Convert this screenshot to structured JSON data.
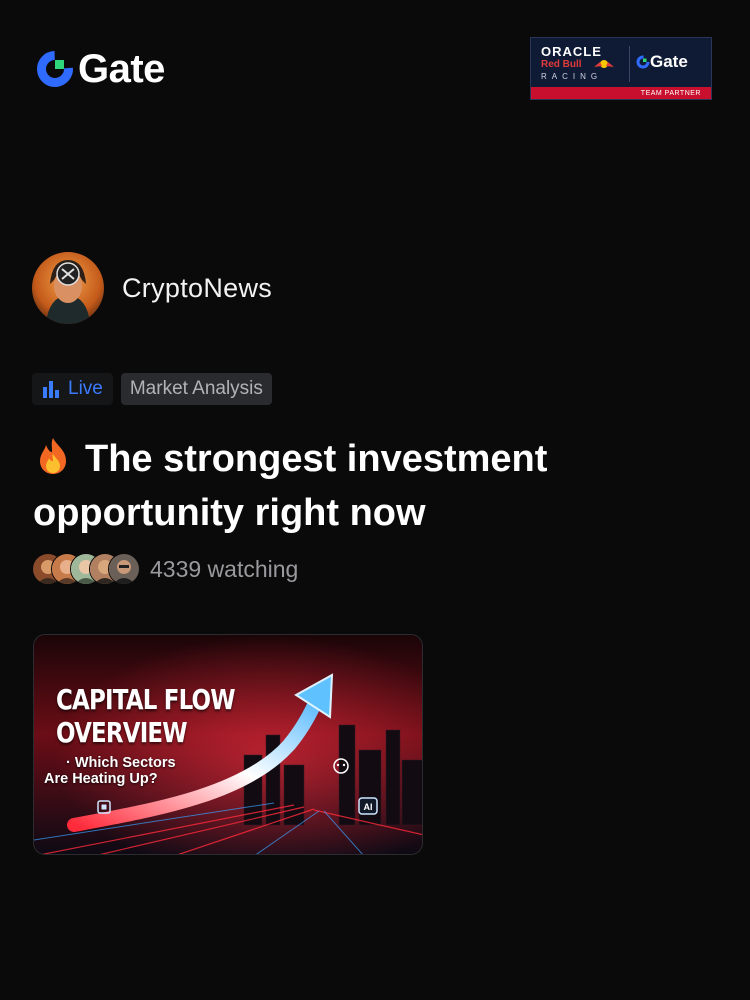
{
  "header": {
    "logo_text": "Gate",
    "partner": {
      "oracle": "ORACLE",
      "redbull": "Red Bull",
      "racing": "RACING",
      "gate": "Gate",
      "badge": "TEAM PARTNER"
    }
  },
  "author": {
    "name": "CryptoNews",
    "avatar_icon": "avatar-xrp-icon"
  },
  "tags": {
    "live_icon": "bar-chart-icon",
    "live": "Live",
    "category": "Market Analysis"
  },
  "post": {
    "title_icon": "fire-emoji",
    "title": "The strongest investment opportunity right now"
  },
  "audience": {
    "watching": "4339 watching"
  },
  "thumbnail": {
    "title_line1": "CAPITAL FLOW",
    "title_line2": "OVERVIEW",
    "subtitle_line1": "· Which Sectors",
    "subtitle_line2": "Are Heating Up?",
    "ai_badge": "AI"
  },
  "colors": {
    "background": "#0a0a0b",
    "live_accent": "#3a7bfd",
    "gate_blue": "#2f6bff",
    "gate_green": "#2fd57a",
    "partner_bg": "#0f1a35",
    "partner_band": "#c8102e"
  }
}
